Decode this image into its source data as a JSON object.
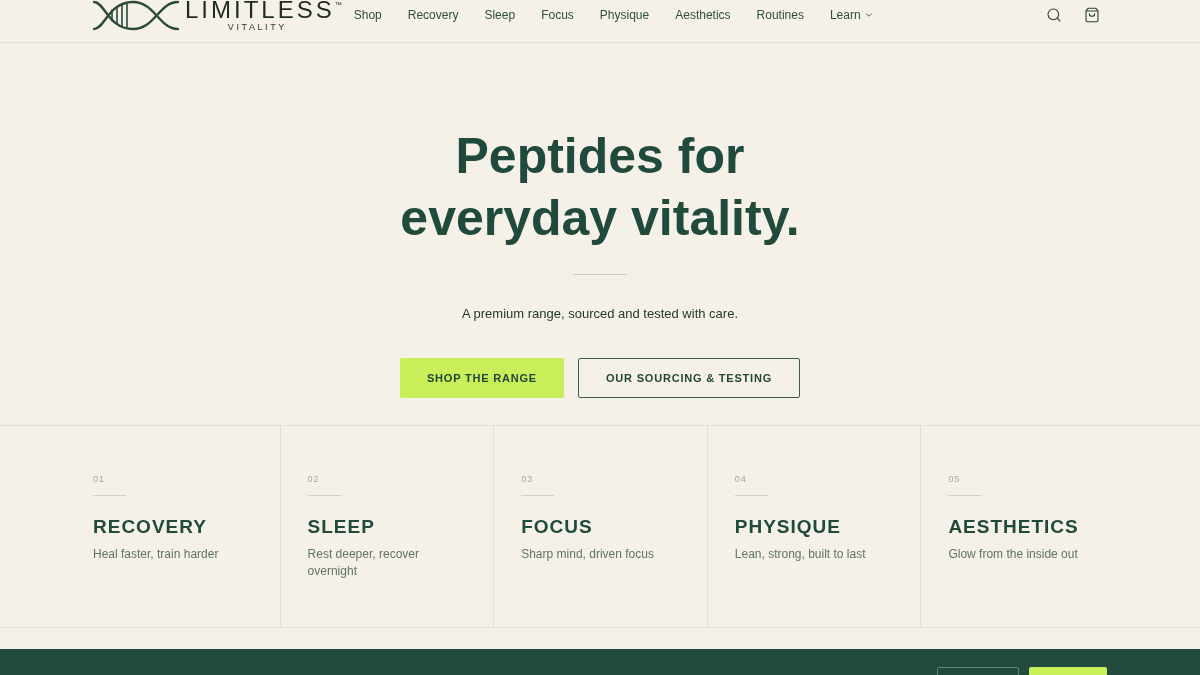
{
  "header": {
    "logo": {
      "wordmark": "LIMITLESS",
      "trademark": "™",
      "tagline": "VITALITY"
    },
    "nav": [
      {
        "label": "Shop",
        "has_dropdown": false
      },
      {
        "label": "Recovery",
        "has_dropdown": false
      },
      {
        "label": "Sleep",
        "has_dropdown": false
      },
      {
        "label": "Focus",
        "has_dropdown": false
      },
      {
        "label": "Physique",
        "has_dropdown": false
      },
      {
        "label": "Aesthetics",
        "has_dropdown": false
      },
      {
        "label": "Routines",
        "has_dropdown": false
      },
      {
        "label": "Learn",
        "has_dropdown": true
      }
    ]
  },
  "hero": {
    "title_lines": [
      "Peptides for",
      "everyday vitality."
    ],
    "subtitle": "A premium range, sourced and tested with care.",
    "buttons": [
      {
        "label": "SHOP THE RANGE",
        "kind": "primary"
      },
      {
        "label": "OUR SOURCING & TESTING",
        "kind": "outline"
      }
    ]
  },
  "categories": [
    {
      "number": "01",
      "title": "RECOVERY",
      "description": "Heal faster, train harder"
    },
    {
      "number": "02",
      "title": "SLEEP",
      "description": "Rest deeper, recover overnight"
    },
    {
      "number": "03",
      "title": "FOCUS",
      "description": "Sharp mind, driven focus"
    },
    {
      "number": "04",
      "title": "PHYSIQUE",
      "description": "Lean, strong, built to last"
    },
    {
      "number": "05",
      "title": "AESTHETICS",
      "description": "Glow from the inside out"
    }
  ],
  "bottom_band": {
    "buttons": [
      {
        "kind": "outline"
      },
      {
        "kind": "primary"
      }
    ]
  }
}
